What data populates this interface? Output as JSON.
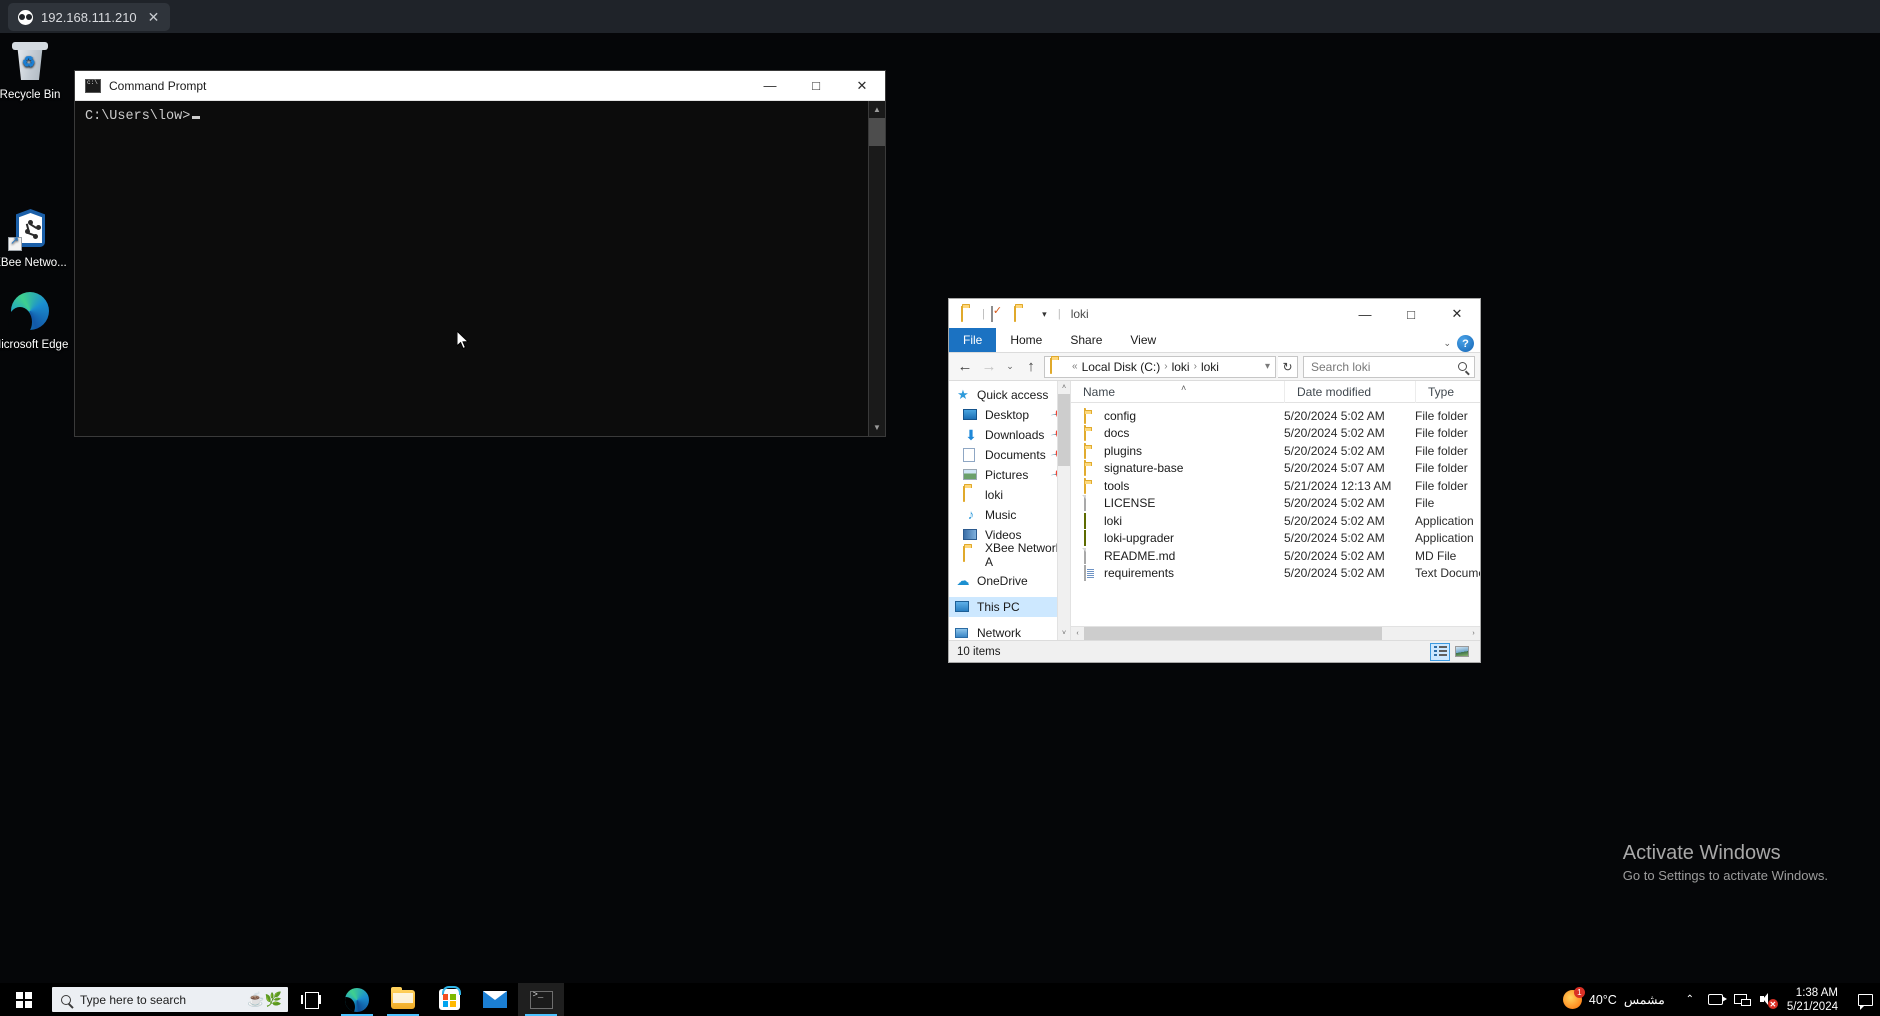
{
  "vnc": {
    "tab_label": "192.168.111.210",
    "tab_icon": "vnc-icon",
    "close_label": "✕"
  },
  "desktop": {
    "icons": [
      {
        "label": "Recycle Bin",
        "icon": "recycle-bin-icon"
      },
      {
        "label": "XBee Netwo...",
        "icon": "xbee-network-assistant-icon"
      },
      {
        "label": "Microsoft Edge",
        "icon": "microsoft-edge-icon"
      }
    ],
    "watermark": {
      "title": "Activate Windows",
      "subtitle": "Go to Settings to activate Windows."
    }
  },
  "cmd_window": {
    "title": "Command Prompt",
    "icon": "command-prompt-icon",
    "prompt_text": "C:\\Users\\low>",
    "minimize_label": "—",
    "maximize_label": "□",
    "close_label": "✕",
    "scroll_up": "▲",
    "scroll_down": "▼"
  },
  "explorer": {
    "title": "loki",
    "quick_access_toolbar": [
      {
        "name": "folder-icon"
      },
      {
        "name": "properties-icon"
      },
      {
        "name": "new-folder-icon"
      },
      {
        "name": "customize-dropdown-icon"
      }
    ],
    "window_controls": {
      "minimize_label": "—",
      "maximize_label": "□",
      "close_label": "✕"
    },
    "ribbon_tabs": [
      {
        "label": "File",
        "active": true
      },
      {
        "label": "Home",
        "active": false
      },
      {
        "label": "Share",
        "active": false
      },
      {
        "label": "View",
        "active": false
      }
    ],
    "ribbon_collapse_label": "⌄",
    "help_label": "?",
    "nav": {
      "back_label": "←",
      "forward_label": "→",
      "recent_label": "⌄",
      "up_label": "↑",
      "refresh_label": "↻",
      "overflow_label": "«"
    },
    "breadcrumb": [
      "Local Disk (C:)",
      "loki",
      "loki"
    ],
    "breadcrumb_separator": "›",
    "search": {
      "placeholder": "Search loki",
      "icon": "search-icon"
    },
    "sidebar": [
      {
        "label": "Quick access",
        "icon": "quick-access-star-icon",
        "pinned": false,
        "root": true,
        "selected": false
      },
      {
        "label": "Desktop",
        "icon": "desktop-icon",
        "pinned": true,
        "root": false,
        "selected": false
      },
      {
        "label": "Downloads",
        "icon": "downloads-icon",
        "pinned": true,
        "root": false,
        "selected": false
      },
      {
        "label": "Documents",
        "icon": "documents-icon",
        "pinned": true,
        "root": false,
        "selected": false
      },
      {
        "label": "Pictures",
        "icon": "pictures-icon",
        "pinned": true,
        "root": false,
        "selected": false
      },
      {
        "label": "loki",
        "icon": "folder-icon",
        "pinned": false,
        "root": false,
        "selected": false
      },
      {
        "label": "Music",
        "icon": "music-icon",
        "pinned": false,
        "root": false,
        "selected": false
      },
      {
        "label": "Videos",
        "icon": "videos-icon",
        "pinned": false,
        "root": false,
        "selected": false
      },
      {
        "label": "XBee Network A",
        "icon": "folder-icon",
        "pinned": false,
        "root": false,
        "selected": false
      },
      {
        "label": "OneDrive",
        "icon": "onedrive-icon",
        "pinned": false,
        "root": true,
        "selected": false
      },
      {
        "label": "This PC",
        "icon": "this-pc-icon",
        "pinned": false,
        "root": true,
        "selected": true
      },
      {
        "label": "Network",
        "icon": "network-icon",
        "pinned": false,
        "root": true,
        "selected": false
      }
    ],
    "columns": [
      {
        "label": "Name"
      },
      {
        "label": "Date modified"
      },
      {
        "label": "Type"
      }
    ],
    "sort_indicator": "˄",
    "files": [
      {
        "name": "config",
        "date": "5/20/2024 5:02 AM",
        "type": "File folder",
        "icon": "folder-icon"
      },
      {
        "name": "docs",
        "date": "5/20/2024 5:02 AM",
        "type": "File folder",
        "icon": "folder-icon"
      },
      {
        "name": "plugins",
        "date": "5/20/2024 5:02 AM",
        "type": "File folder",
        "icon": "folder-icon"
      },
      {
        "name": "signature-base",
        "date": "5/20/2024 5:07 AM",
        "type": "File folder",
        "icon": "folder-icon"
      },
      {
        "name": "tools",
        "date": "5/21/2024 12:13 AM",
        "type": "File folder",
        "icon": "folder-icon"
      },
      {
        "name": "LICENSE",
        "date": "5/20/2024 5:02 AM",
        "type": "File",
        "icon": "blank-file-icon"
      },
      {
        "name": "loki",
        "date": "5/20/2024 5:02 AM",
        "type": "Application",
        "icon": "application-icon"
      },
      {
        "name": "loki-upgrader",
        "date": "5/20/2024 5:02 AM",
        "type": "Application",
        "icon": "application-icon"
      },
      {
        "name": "README.md",
        "date": "5/20/2024 5:02 AM",
        "type": "MD File",
        "icon": "blank-file-icon"
      },
      {
        "name": "requirements",
        "date": "5/20/2024 5:02 AM",
        "type": "Text Document",
        "icon": "text-document-icon"
      }
    ],
    "status_text": "10 items",
    "view_buttons": [
      {
        "name": "details-view-button",
        "active": true
      },
      {
        "name": "large-icons-view-button",
        "active": false
      }
    ],
    "hscroll": {
      "left_label": "‹",
      "right_label": "›"
    },
    "vscroll": {
      "up_label": "˄",
      "down_label": "˅"
    }
  },
  "taskbar": {
    "start_label": "start-button",
    "search_placeholder": "Type here to search",
    "search_icon": "search-icon",
    "buttons": [
      {
        "name": "task-view-button"
      },
      {
        "name": "microsoft-edge-taskbar-button"
      },
      {
        "name": "file-explorer-taskbar-button"
      },
      {
        "name": "microsoft-store-taskbar-button"
      },
      {
        "name": "mail-taskbar-button"
      },
      {
        "name": "command-prompt-taskbar-button"
      }
    ],
    "tray": {
      "weather_temp": "40°C",
      "weather_condition": "مشمس",
      "weather_badge": "1",
      "overflow_label": "⌃",
      "time": "1:38 AM",
      "date": "5/21/2024",
      "notification_icon": "action-center-icon"
    }
  }
}
